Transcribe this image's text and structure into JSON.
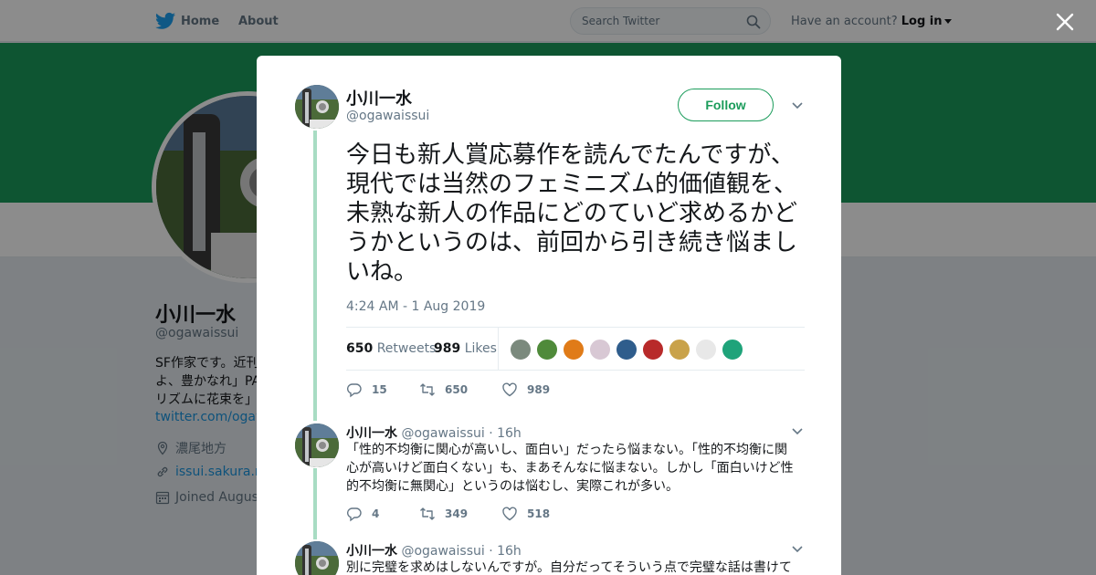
{
  "topbar": {
    "home_label": "Home",
    "about_label": "About",
    "search_placeholder": "Search Twitter",
    "account_prompt": "Have an account?",
    "login_label": "Log in"
  },
  "background_profile": {
    "name": "小川一水",
    "handle": "@ogawaissui",
    "bio": "SF作家です。近刊\nよ、豊かなれ」PA\nリズムに花束を」",
    "link": "twitter.com/ogawa",
    "location": "濃尾地方",
    "website": "issui.sakura.ne",
    "joined": "Joined August",
    "banner_color": "#1b9c5b"
  },
  "main_tweet": {
    "name": "小川一水",
    "handle": "@ogawaissui",
    "follow_label": "Follow",
    "text": "今日も新人賞応募作を読んでたんですが、現代では当然のフェミニズム的価値観を、未熟な新人の作品にどのていど求めるかどうかというのは、前回から引き続き悩ましいね。",
    "timestamp": "4:24 AM - 1 Aug 2019",
    "retweets_count": "650",
    "retweets_label": "Retweets",
    "likes_count": "989",
    "likes_label": "Likes",
    "liker_colors": [
      "#7b8a7d",
      "#4f8a3a",
      "#e07b18",
      "#d8c8d4",
      "#2f5d8c",
      "#b82a2a",
      "#c9a24a",
      "#e8e8e8",
      "#1fa37a"
    ],
    "reply_count": "15",
    "retweet_count": "650",
    "like_count": "989"
  },
  "replies": [
    {
      "name": "小川一水",
      "handle": "@ogawaissui",
      "time": "· 16h",
      "text": "「性的不均衡に関心が高いし、面白い」だったら悩まない。「性的不均衡に関心が高いけど面白くない」も、まあそんなに悩まない。しかし「面白いけど性的不均衡に無関心」というのは悩むし、実際これが多い。",
      "reply_count": "4",
      "retweet_count": "349",
      "like_count": "518"
    },
    {
      "name": "小川一水",
      "handle": "@ogawaissui",
      "time": "· 16h",
      "text": "別に完璧を求めはしないんですが。自分だってそういう点で完璧な話は書けて"
    }
  ],
  "colors": {
    "accent": "#1b9c5b",
    "thread_line": "#a8dcc3",
    "secondary_text": "#657786",
    "link": "#1b95e0"
  }
}
